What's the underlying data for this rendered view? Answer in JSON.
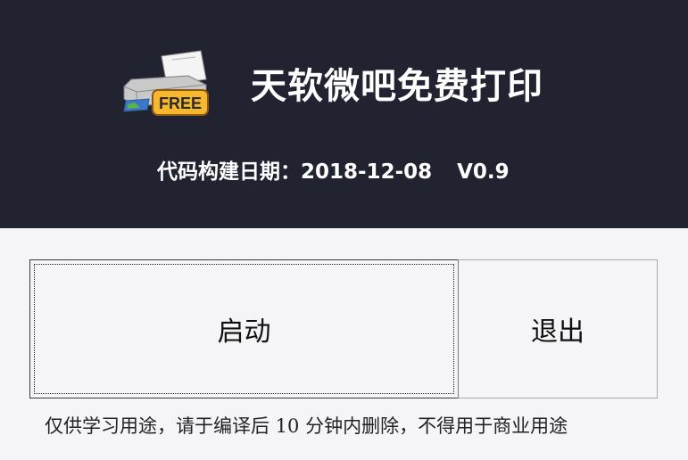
{
  "header": {
    "title": "天软微吧免费打印",
    "build_label": "代码构建日期：",
    "build_date": "2018-12-08",
    "version": "V0.9",
    "logo_icon": "printer-free-icon",
    "logo_badge": "FREE"
  },
  "buttons": {
    "start_label": "启动",
    "exit_label": "退出"
  },
  "footer": {
    "disclaimer": "仅供学习用途，请于编译后 10 分钟内删除，不得用于商业用途"
  },
  "colors": {
    "header_bg": "#222331",
    "body_bg": "#f5f5f7",
    "badge_fill": "#f5b82e"
  }
}
